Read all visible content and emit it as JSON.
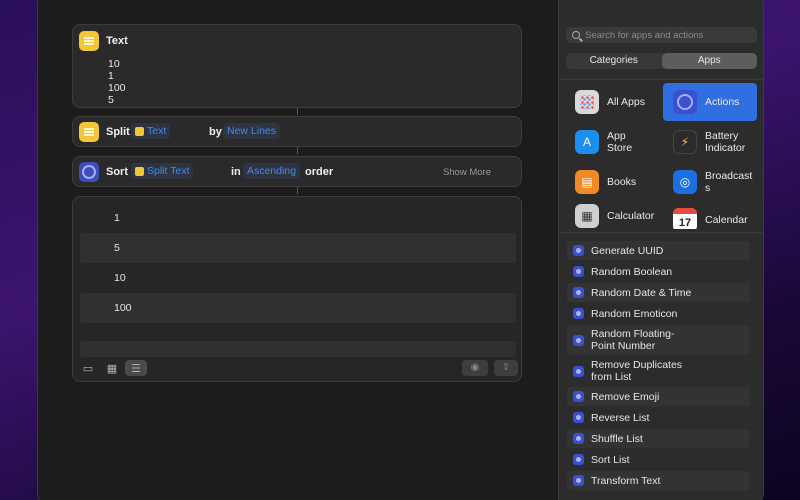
{
  "editor": {
    "text_action": {
      "title": "Text",
      "lines": [
        "10",
        "1",
        "100",
        "5"
      ]
    },
    "split_action": {
      "title": "Split",
      "input_token": "Text",
      "by_word": "by",
      "separator_token": "New Lines"
    },
    "sort_action": {
      "title": "Sort",
      "input_token": "Split Text",
      "in_word": "in",
      "order_token": "Ascending",
      "order_word": "order",
      "show_more": "Show More"
    },
    "result": {
      "rows": [
        "1",
        "5",
        "10",
        "100"
      ]
    }
  },
  "sidebar": {
    "search_placeholder": "Search for apps and actions",
    "segments": [
      "Categories",
      "Apps"
    ],
    "selected_segment": "Apps",
    "apps": [
      {
        "label": "All Apps",
        "icon": "all-apps-icon"
      },
      {
        "label": "Actions",
        "icon": "actions-icon",
        "selected": true
      },
      {
        "label": "App Store",
        "icon": "app-store-icon"
      },
      {
        "label": "Battery Indicator",
        "icon": "battery-icon"
      },
      {
        "label": "Books",
        "icon": "books-icon"
      },
      {
        "label": "Broadcasts",
        "icon": "broadcasts-icon"
      },
      {
        "label": "Calculator",
        "icon": "calculator-icon"
      },
      {
        "label": "Calendar",
        "icon": "calendar-icon",
        "day": "17"
      }
    ],
    "actions": [
      "Generate UUID",
      "Random Boolean",
      "Random Date & Time",
      "Random Emoticon",
      "Random Floating-Point Number",
      "Remove Duplicates from List",
      "Remove Emoji",
      "Reverse List",
      "Shuffle List",
      "Sort List",
      "Transform Text"
    ]
  },
  "colors": {
    "accent": "#2f6fe0",
    "token_text": "#3e8cf5",
    "text_icon": "#f3c53b",
    "actions_icon": "#3b4fd0"
  }
}
